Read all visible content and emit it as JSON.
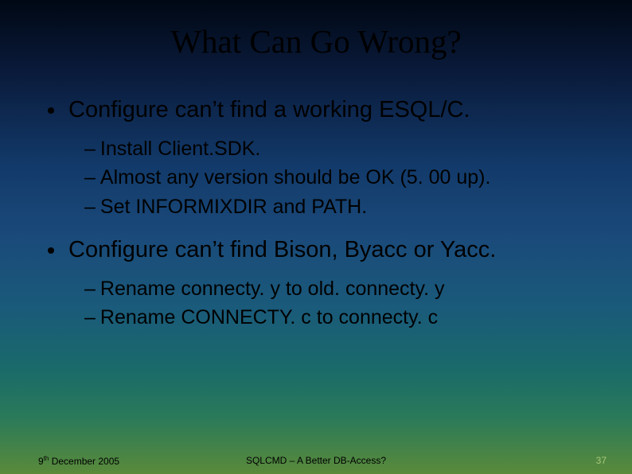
{
  "title": "What Can Go Wrong?",
  "bullets": [
    {
      "text": "Configure can’t find a working ESQL/C.",
      "sub": [
        "Install Client.SDK.",
        "Almost any version should be OK (5. 00 up).",
        "Set INFORMIXDIR and PATH."
      ]
    },
    {
      "text": "Configure can’t find Bison, Byacc or Yacc.",
      "sub": [
        "Rename connecty. y to old. connecty. y",
        "Rename CONNECTY. c to connecty. c"
      ]
    }
  ],
  "footer": {
    "date_prefix": "9",
    "date_suffix": "th",
    "date_rest": " December 2005",
    "center": "SQLCMD – A Better DB-Access?",
    "page": "37"
  }
}
